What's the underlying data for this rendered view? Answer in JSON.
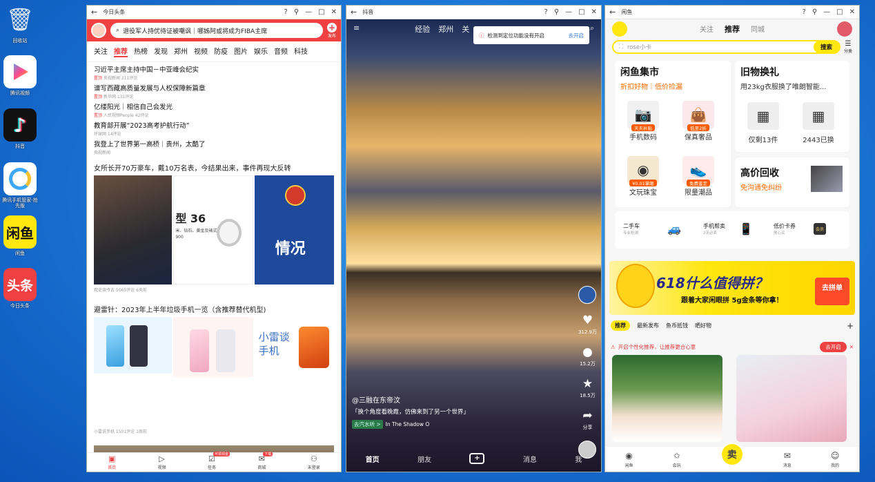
{
  "desktop": {
    "icons": [
      {
        "label": "回收站",
        "kind": "recycle"
      },
      {
        "label": "腾讯视频",
        "kind": "video"
      },
      {
        "label": "抖音",
        "kind": "douyin"
      },
      {
        "label": "腾讯手机管家-抢先版",
        "kind": "guard"
      },
      {
        "label": "闲鱼",
        "kind": "xianyu"
      },
      {
        "label": "今日头条",
        "kind": "toutiao"
      }
    ]
  },
  "toutiao": {
    "title": "今日头条",
    "search_text": "退役军人持优待证被嘲讽｜哪姊阿或将成为FIBA主席",
    "publish_label": "发布",
    "tabs": [
      "关注",
      "推荐",
      "热榜",
      "发现",
      "郑州",
      "视频",
      "防疫",
      "图片",
      "娱乐",
      "音频",
      "科技"
    ],
    "active_tab": "推荐",
    "news": [
      {
        "title": "习近平主席主持中国－中亚峰会纪实",
        "tag": "置顶",
        "meta": "央视新闻 211评论"
      },
      {
        "title": "谱写西藏高质量发展与人权保障新篇章",
        "tag": "置顶",
        "meta": "新华网 131评论"
      },
      {
        "title": "亿缕阳光｜相信自己会发光",
        "tag": "置顶",
        "meta": "人民视频People 42评论"
      },
      {
        "title": "教育部开展“2023高考护航行动”",
        "tag": "",
        "meta": "环球网 14评论"
      },
      {
        "title": "我登上了世界第一高桥｜贵州，太酷了",
        "tag": "",
        "meta": "央视新闻"
      }
    ],
    "article1": {
      "title": "女所长开70万豪车，戴10万名表，今结果出来，事件再现大反转",
      "img_text_a": "型 36",
      "img_text_b": "米、钻石、黄金及裱式钢",
      "img_text_c": "900",
      "img_text_d": "情况",
      "meta": "观史谈今古 5065评论 6天前"
    },
    "article2": {
      "title": "避雷针：2023年上半年垃圾手机一览（含推荐替代机型)",
      "img_text": "小雷谈手机",
      "meta": "小雷说手机 1501评论 1周前"
    },
    "bottom": [
      {
        "label": "首页",
        "icon": "home-icon",
        "badge": ""
      },
      {
        "label": "视频",
        "icon": "video-icon",
        "badge": ""
      },
      {
        "label": "任务",
        "icon": "task-icon",
        "badge": "可领现金"
      },
      {
        "label": "商城",
        "icon": "mall-icon",
        "badge": "下载"
      },
      {
        "label": "未登录",
        "icon": "user-icon",
        "badge": ""
      }
    ]
  },
  "douyin": {
    "title": "抖音",
    "top_tabs": [
      "经验",
      "郑州",
      "关"
    ],
    "toast": {
      "text": "检测到定位功能没有开启",
      "action": "去开启"
    },
    "right": [
      {
        "icon": "heart-icon",
        "count": "312.9万"
      },
      {
        "icon": "comment-icon",
        "count": "15.2万"
      },
      {
        "icon": "star-icon",
        "count": "18.5万"
      },
      {
        "icon": "share-icon",
        "count": "分享"
      }
    ],
    "user": "@三融在东帝汶",
    "desc": "「换个角度看晚霞，仿佛来到了另一个世界」",
    "music_tag": "去汽水听 >",
    "music": "In The Shadow O",
    "bottom": [
      "首页",
      "朋友",
      "+",
      "消息",
      "我"
    ]
  },
  "xianyu": {
    "title": "闲鱼",
    "tabs": [
      "关注",
      "推荐",
      "同城"
    ],
    "active_tab": "推荐",
    "search_placeholder": "rose小卡",
    "search_button": "搜索",
    "cat_label": "分类",
    "market": {
      "title": "闲鱼集市",
      "sub": "折扣好物｜低价捡漏",
      "items": [
        {
          "name": "手机数码",
          "pill": "天天补贴"
        },
        {
          "name": "保真奢品",
          "pill": "低至2折"
        },
        {
          "name": "文玩珠宝",
          "pill": "¥0.01掌眼"
        },
        {
          "name": "限量潮品",
          "pill": "免费鉴定"
        }
      ]
    },
    "swap": {
      "title": "旧物换礼",
      "sub": "用23kg衣服换了唯朗智能...",
      "items": [
        "仅剩13件",
        "2443已换"
      ],
      "recycle_title": "高价回收",
      "recycle_sub": "免沟通免纠纷"
    },
    "services": [
      {
        "name": "二手车",
        "sub": "专业检测"
      },
      {
        "name": "手机帮卖",
        "sub": "2天必卖"
      },
      {
        "name": "低价卡券",
        "sub": "放心买"
      },
      {
        "name": "会员",
        "sub": ""
      }
    ],
    "banner": {
      "big": "618什么值得拼？",
      "small": "跟着大家闲眼拼 5g金条等你拿！",
      "btn": "去拼单"
    },
    "feed_tabs": [
      "推荐",
      "最新发布",
      "鱼币抵钱",
      "晒好物"
    ],
    "notice": {
      "text": "开启个性化推荐，让推荐更合心意",
      "btn": "去开启"
    },
    "bottom": [
      {
        "label": "闲鱼",
        "icon": "fish-icon"
      },
      {
        "label": "会玩",
        "icon": "play-icon"
      },
      {
        "label": "卖",
        "icon": "sell-icon"
      },
      {
        "label": "消息",
        "icon": "message-icon"
      },
      {
        "label": "我的",
        "icon": "me-icon"
      }
    ],
    "sell_label": "卖"
  }
}
